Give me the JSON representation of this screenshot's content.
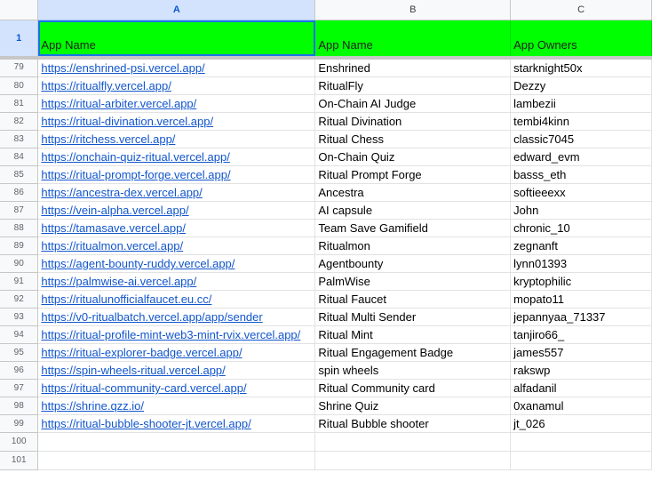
{
  "column_headers": [
    "A",
    "B",
    "C"
  ],
  "header_row": {
    "row_number": "1",
    "cells": [
      "App Name",
      "App Name",
      "App Owners"
    ]
  },
  "rows": [
    {
      "n": "79",
      "url": "https://enshrined-psi.vercel.app/",
      "name": "Enshrined",
      "owner": "starknight50x"
    },
    {
      "n": "80",
      "url": "https://ritualfly.vercel.app/",
      "name": "RitualFly",
      "owner": "Dezzy"
    },
    {
      "n": "81",
      "url": "https://ritual-arbiter.vercel.app/",
      "name": "On-Chain AI Judge",
      "owner": "lambezii"
    },
    {
      "n": "82",
      "url": "https://ritual-divination.vercel.app/",
      "name": "Ritual Divination",
      "owner": "tembi4kinn"
    },
    {
      "n": "83",
      "url": "https://ritchess.vercel.app/",
      "name": "Ritual Chess",
      "owner": "classic7045"
    },
    {
      "n": "84",
      "url": "https://onchain-quiz-ritual.vercel.app/",
      "name": "On-Chain Quiz",
      "owner": "edward_evm"
    },
    {
      "n": "85",
      "url": "https://ritual-prompt-forge.vercel.app/",
      "name": "Ritual Prompt Forge",
      "owner": "basss_eth"
    },
    {
      "n": "86",
      "url": "https://ancestra-dex.vercel.app/",
      "name": "Ancestra",
      "owner": "softieeexx"
    },
    {
      "n": "87",
      "url": "https://vein-alpha.vercel.app/",
      "name": "AI capsule",
      "owner": "John"
    },
    {
      "n": "88",
      "url": "https://tamasave.vercel.app/",
      "name": "Team Save Gamifield",
      "owner": "chronic_10"
    },
    {
      "n": "89",
      "url": "https://ritualmon.vercel.app/",
      "name": "Ritualmon",
      "owner": "zegnanft"
    },
    {
      "n": "90",
      "url": "https://agent-bounty-ruddy.vercel.app/",
      "name": "Agentbounty",
      "owner": "lynn01393"
    },
    {
      "n": "91",
      "url": "https://palmwise-ai.vercel.app/",
      "name": "PalmWise",
      "owner": "kryptophilic"
    },
    {
      "n": "92",
      "url": "https://ritualunofficialfaucet.eu.cc/",
      "name": "Ritual Faucet",
      "owner": "mopato11"
    },
    {
      "n": "93",
      "url": "https://v0-ritualbatch.vercel.app/app/sender",
      "name": "Ritual Multi Sender",
      "owner": "jepannyaa_71337"
    },
    {
      "n": "94",
      "url": "https://ritual-profile-mint-web3-mint-rvix.vercel.app/",
      "name": "Ritual Mint",
      "owner": "tanjiro66_"
    },
    {
      "n": "95",
      "url": "https://ritual-explorer-badge.vercel.app/",
      "name": "Ritual Engagement Badge",
      "owner": "james557"
    },
    {
      "n": "96",
      "url": "https://spin-wheels-ritual.vercel.app/",
      "name": "spin wheels",
      "owner": "rakswp"
    },
    {
      "n": "97",
      "url": "https://ritual-community-card.vercel.app/",
      "name": "Ritual Community card",
      "owner": "alfadanil"
    },
    {
      "n": "98",
      "url": "https://shrine.qzz.io/",
      "name": "Shrine Quiz",
      "owner": "0xanamul"
    },
    {
      "n": "99",
      "url": "https://ritual-bubble-shooter-jt.vercel.app/",
      "name": "Ritual Bubble shooter",
      "owner": "jt_026"
    },
    {
      "n": "100",
      "url": "",
      "name": "",
      "owner": ""
    },
    {
      "n": "101",
      "url": "",
      "name": "",
      "owner": ""
    }
  ],
  "colors": {
    "header_fill": "#00ff00",
    "link": "#1155cc",
    "selection": "#d3e3fd",
    "active_border": "#1a73e8"
  }
}
